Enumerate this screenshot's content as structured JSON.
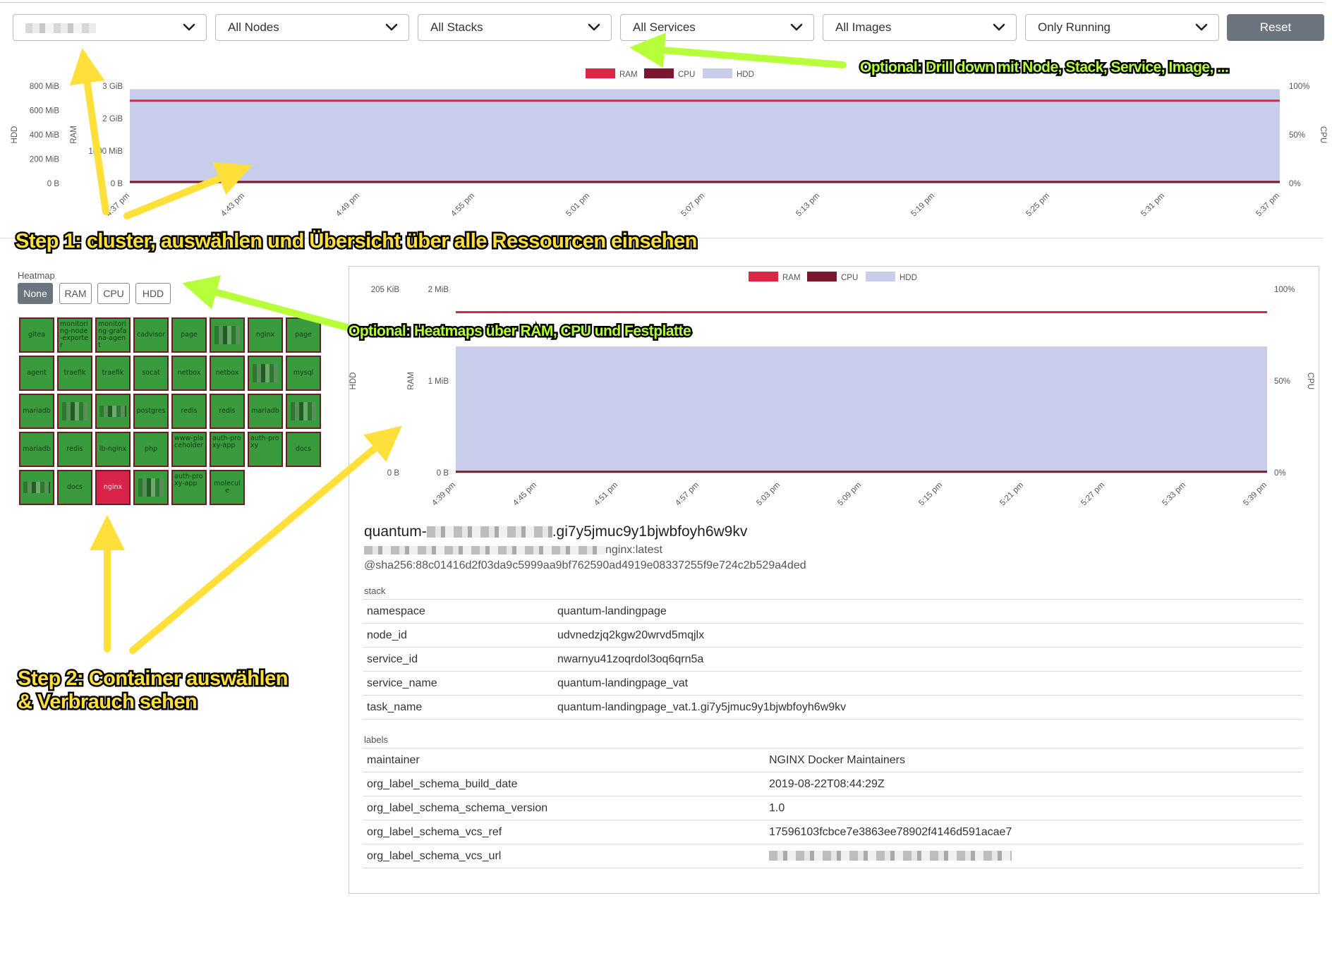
{
  "filters": {
    "cluster": {
      "value": ""
    },
    "nodes": {
      "value": "All Nodes"
    },
    "stacks": {
      "value": "All Stacks"
    },
    "services": {
      "value": "All Services"
    },
    "images": {
      "value": "All Images"
    },
    "running": {
      "value": "Only Running"
    },
    "reset_label": "Reset"
  },
  "annotations": {
    "drill_down": "Optional: Drill down mit Node, Stack, Service, Image, ...",
    "step1": "Step 1: cluster, auswählen und Übersicht über alle Ressourcen einsehen",
    "heatmaps": "Optional: Heatmaps über RAM, CPU und Festplatte",
    "step2_line1": "Step 2: Container auswählen",
    "step2_line2": "& Verbrauch sehen"
  },
  "colors": {
    "ram": "#dc2646",
    "cpu": "#7a1830",
    "hdd": "#c9cdec",
    "tile_green": "#3a9b3e",
    "tile_selected": "#d9234b",
    "annotation_yellow": "#ffe03a",
    "annotation_green": "#b7ff3a"
  },
  "chart_data": [
    {
      "type": "area",
      "legend": [
        "RAM",
        "CPU",
        "HDD"
      ],
      "x": [
        "4:37 pm",
        "4:43 pm",
        "4:49 pm",
        "4:55 pm",
        "5:01 pm",
        "5:07 pm",
        "5:13 pm",
        "5:19 pm",
        "5:25 pm",
        "5:31 pm",
        "5:37 pm"
      ],
      "hdd_axis": {
        "label": "HDD",
        "ticks": [
          "800 MiB",
          "600 MiB",
          "400 MiB",
          "200 MiB",
          "0 B"
        ],
        "ylim": [
          0,
          800
        ]
      },
      "ram_axis": {
        "label": "RAM",
        "ticks": [
          "3 GiB",
          "2 GiB",
          "1000 MiB",
          "0 B"
        ],
        "ylim": [
          0,
          3
        ]
      },
      "cpu_axis": {
        "label": "CPU",
        "ticks": [
          "100%",
          "50%",
          "0%"
        ],
        "ylim": [
          0,
          100
        ]
      },
      "series": [
        {
          "name": "HDD",
          "axis": "hdd",
          "values": [
            775,
            775,
            775,
            775,
            775,
            775,
            775,
            775,
            775,
            775,
            775
          ]
        },
        {
          "name": "RAM",
          "axis": "ram",
          "values": [
            2.55,
            2.55,
            2.55,
            2.55,
            2.55,
            2.55,
            2.55,
            2.55,
            2.55,
            2.55,
            2.55
          ]
        },
        {
          "name": "CPU",
          "axis": "cpu",
          "values": [
            1.5,
            1.5,
            1.5,
            1.5,
            1.5,
            1.5,
            1.5,
            1.5,
            1.5,
            1.5,
            1.5
          ]
        }
      ]
    },
    {
      "type": "area",
      "legend": [
        "RAM",
        "CPU",
        "HDD"
      ],
      "x": [
        "4:39 pm",
        "4:45 pm",
        "4:51 pm",
        "4:57 pm",
        "5:03 pm",
        "5:09 pm",
        "5:15 pm",
        "5:21 pm",
        "5:27 pm",
        "5:33 pm",
        "5:39 pm"
      ],
      "hdd_axis": {
        "label": "HDD",
        "ticks": [
          "205 KiB",
          "0 B"
        ],
        "ylim": [
          0,
          205
        ]
      },
      "ram_axis": {
        "label": "RAM",
        "ticks": [
          "2 MiB",
          "1 MiB",
          "0 B"
        ],
        "ylim": [
          0,
          2
        ]
      },
      "cpu_axis": {
        "label": "CPU",
        "ticks": [
          "100%",
          "50%",
          "0%"
        ],
        "ylim": [
          0,
          100
        ]
      },
      "series": [
        {
          "name": "HDD",
          "axis": "hdd",
          "values": [
            141,
            141,
            141,
            141,
            141,
            141,
            141,
            141,
            141,
            141,
            141
          ]
        },
        {
          "name": "RAM",
          "axis": "ram",
          "values": [
            1.75,
            1.75,
            1.75,
            1.75,
            1.75,
            1.75,
            1.75,
            1.75,
            1.75,
            1.75,
            1.75
          ]
        },
        {
          "name": "CPU",
          "axis": "cpu",
          "values": [
            0.5,
            0.5,
            0.5,
            0.5,
            0.5,
            0.5,
            0.5,
            0.5,
            0.5,
            0.5,
            0.5
          ]
        }
      ]
    }
  ],
  "heatmap": {
    "label": "Heatmap",
    "buttons": [
      "None",
      "RAM",
      "CPU",
      "HDD"
    ],
    "active": "None",
    "tiles": [
      [
        "gitea",
        "monitoring-node-exporter",
        "monitoring-grafana-agent",
        "cadvisor",
        "page",
        "",
        "nginx",
        "page"
      ],
      [
        "agent",
        "traefik",
        "traefik",
        "socat",
        "netbox",
        "netbox",
        "",
        "mysql"
      ],
      [
        "mariadb",
        "",
        "",
        "postgres",
        "redis",
        "redis",
        "mariadb",
        ""
      ],
      [
        "mariadb",
        "redis",
        "lb-nginx",
        "php",
        "www-placeholder",
        "auth-proxy-app",
        "auth-proxy",
        "docs"
      ],
      [
        "",
        "docs",
        "nginx",
        "",
        "auth-proxy-app",
        "molecule"
      ]
    ],
    "selected": "nginx"
  },
  "details": {
    "title_prefix": "quantum-",
    "title_suffix": ".gi7y5jmuc9y1bjwbfoyh6w9kv",
    "image_suffix": "nginx:latest",
    "sha": "@sha256:88c01416d2f03da9c5999aa9bf762590ad4919e08337255f9e724c2b529a4ded",
    "stack_label": "stack",
    "stack_rows": [
      {
        "key": "namespace",
        "value": "quantum-landingpage"
      },
      {
        "key": "node_id",
        "value": "udvnedzjq2kgw20wrvd5mqjlx"
      },
      {
        "key": "service_id",
        "value": "nwarnyu41zoqrdol3oq6qrn5a"
      },
      {
        "key": "service_name",
        "value": "quantum-landingpage_vat"
      },
      {
        "key": "task_name",
        "value": "quantum-landingpage_vat.1.gi7y5jmuc9y1bjwbfoyh6w9kv"
      }
    ],
    "labels_label": "labels",
    "label_rows": [
      {
        "key": "maintainer",
        "value": "NGINX Docker Maintainers"
      },
      {
        "key": "org_label_schema_build_date",
        "value": "2019-08-22T08:44:29Z"
      },
      {
        "key": "org_label_schema_schema_version",
        "value": "1.0"
      },
      {
        "key": "org_label_schema_vcs_ref",
        "value": "17596103fcbce7e3863ee78902f4146d591acae7"
      },
      {
        "key": "org_label_schema_vcs_url",
        "value": ""
      }
    ]
  }
}
